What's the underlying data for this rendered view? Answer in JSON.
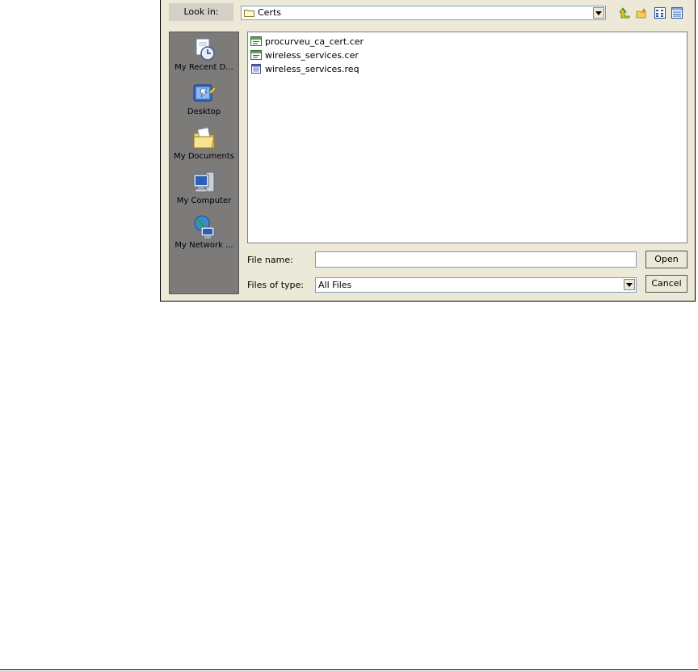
{
  "dialog": {
    "look_in_label": "Look in:",
    "look_in_value": "Certs",
    "toolbar_icons": [
      "up-one-level-icon",
      "create-new-folder-icon",
      "list-view-icon",
      "details-view-icon"
    ]
  },
  "places": [
    {
      "label": "My Recent D...",
      "icon": "recent-documents-icon"
    },
    {
      "label": "Desktop",
      "icon": "desktop-icon"
    },
    {
      "label": "My Documents",
      "icon": "my-documents-icon"
    },
    {
      "label": "My Computer",
      "icon": "my-computer-icon"
    },
    {
      "label": "My Network ...",
      "icon": "my-network-icon"
    }
  ],
  "files": [
    {
      "name": "procurveu_ca_cert.cer",
      "icon": "certificate-icon"
    },
    {
      "name": "wireless_services.cer",
      "icon": "certificate-icon"
    },
    {
      "name": "wireless_services.req",
      "icon": "request-file-icon"
    }
  ],
  "bottom": {
    "file_name_label": "File name:",
    "file_name_value": "",
    "files_of_type_label": "Files of type:",
    "files_of_type_value": "All Files",
    "open_label": "Open",
    "cancel_label": "Cancel"
  },
  "colors": {
    "dialog_bg": "#ece9d8",
    "places_bg": "#7d7b7a",
    "input_border": "#7f9db9"
  }
}
